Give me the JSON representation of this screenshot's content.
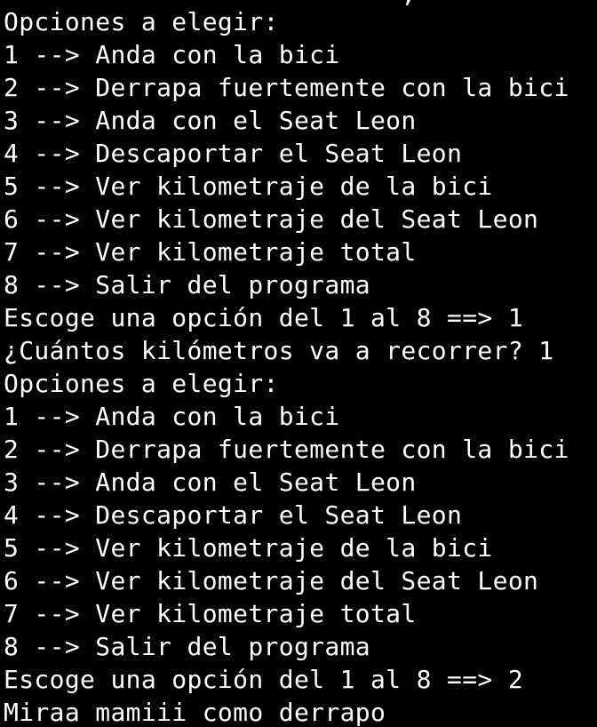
{
  "terminal": {
    "partial_top_line": "                          ,             ,  _",
    "lines": [
      "Opciones a elegir:",
      "1 --> Anda con la bici",
      "2 --> Derrapa fuertemente con la bici",
      "3 --> Anda con el Seat Leon",
      "4 --> Descaportar el Seat Leon",
      "5 --> Ver kilometraje de la bici",
      "6 --> Ver kilometraje del Seat Leon",
      "7 --> Ver kilometraje total",
      "8 --> Salir del programa",
      "Escoge una opción del 1 al 8 ==> 1",
      "¿Cuántos kilómetros va a recorrer? 1",
      "Opciones a elegir:",
      "1 --> Anda con la bici",
      "2 --> Derrapa fuertemente con la bici",
      "3 --> Anda con el Seat Leon",
      "4 --> Descaportar el Seat Leon",
      "5 --> Ver kilometraje de la bici",
      "6 --> Ver kilometraje del Seat Leon",
      "7 --> Ver kilometraje total",
      "8 --> Salir del programa",
      "Escoge una opción del 1 al 8 ==> 2",
      "Miraa mamiii como derrapo"
    ],
    "colors": {
      "background": "#000000",
      "text": "#ffffff"
    }
  }
}
